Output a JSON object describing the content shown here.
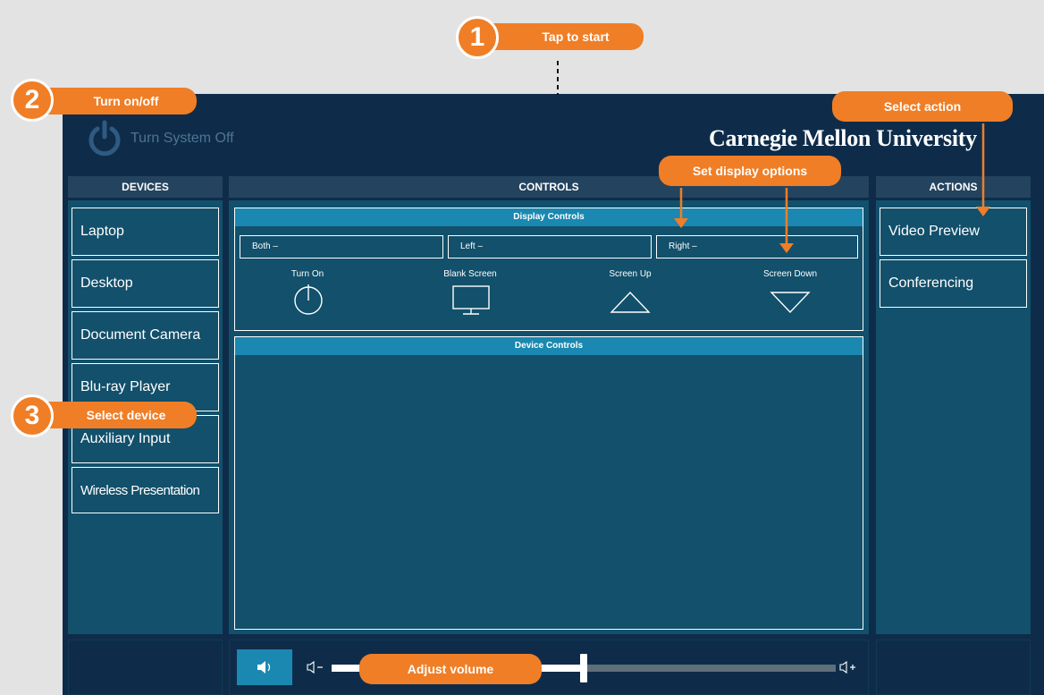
{
  "header": {
    "power_label": "Turn System Off",
    "brand": "Carnegie Mellon University"
  },
  "columns": {
    "devices": "DEVICES",
    "controls": "CONTROLS",
    "actions": "ACTIONS"
  },
  "devices": [
    {
      "label": "Laptop"
    },
    {
      "label": "Desktop"
    },
    {
      "label": "Document Camera"
    },
    {
      "label": "Blu-ray Player"
    },
    {
      "label": "Auxiliary Input"
    },
    {
      "label": "Wireless Presentation"
    }
  ],
  "display_controls": {
    "title": "Display Controls",
    "selectors": [
      {
        "label": "Both –"
      },
      {
        "label": "Left –"
      },
      {
        "label": "Right –"
      }
    ],
    "buttons": [
      {
        "label": "Turn On",
        "icon": "power-icon"
      },
      {
        "label": "Blank Screen",
        "icon": "monitor-icon"
      },
      {
        "label": "Screen Up",
        "icon": "triangle-up-icon"
      },
      {
        "label": "Screen Down",
        "icon": "triangle-down-icon"
      }
    ]
  },
  "device_controls": {
    "title": "Device Controls"
  },
  "actions": [
    {
      "label": "Video Preview"
    },
    {
      "label": "Conferencing"
    }
  ],
  "volume": {
    "level": 0.5,
    "mute_icon": "speaker-icon",
    "down_icon": "volume-down-icon",
    "up_icon": "volume-up-icon"
  },
  "callouts": {
    "step1_number": "1",
    "step1_text": "Tap to start",
    "step2_number": "2",
    "step2_text": "Turn on/off",
    "step3_number": "3",
    "step3_text": "Select device",
    "select_action": "Select action",
    "display_options": "Set display options",
    "adjust_volume": "Adjust volume"
  },
  "colors": {
    "accent": "#f07e26",
    "panel": "#0e2c4a",
    "column": "#12506b",
    "sub_header": "#1a88b0"
  }
}
